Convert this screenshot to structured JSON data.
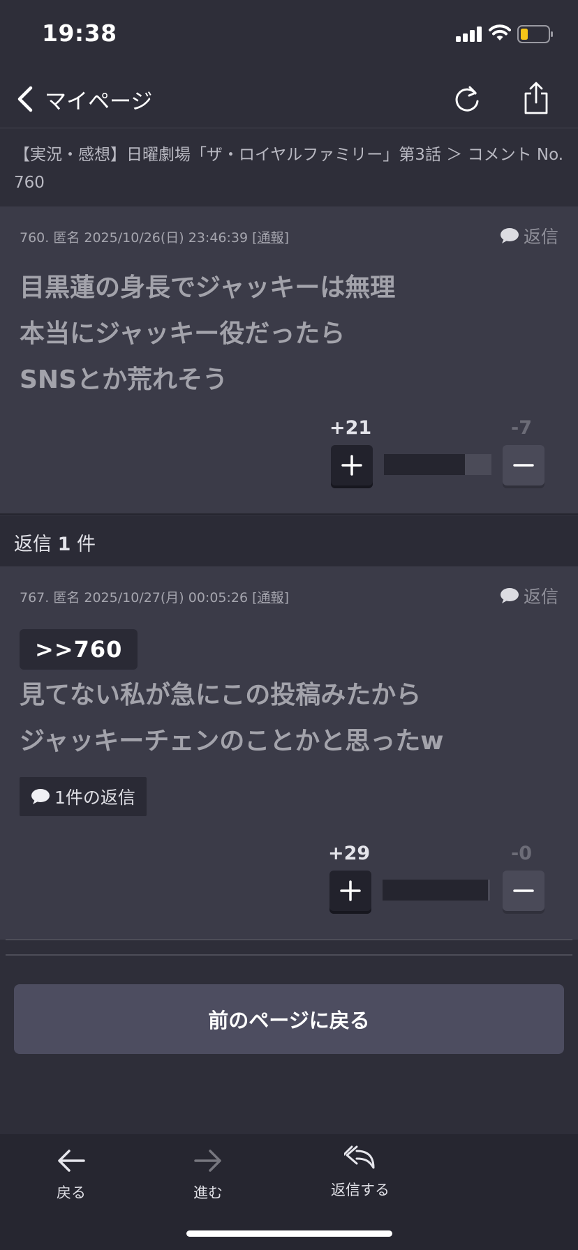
{
  "status_bar": {
    "time": "19:38",
    "battery_color": "#f5c518",
    "icons": [
      "signal-icon",
      "wifi-icon",
      "battery-icon"
    ]
  },
  "nav": {
    "back_label": "マイページ",
    "icons": [
      "chevron-left-icon",
      "reload-icon",
      "share-icon"
    ]
  },
  "breadcrumb": "【実況・感想】日曜劇場「ザ・ロイヤルファミリー」第3話 ＞ コメント No. 760",
  "comments": [
    {
      "meta_prefix": "760. 匿名 2025/10/26(日) 23:46:39 [",
      "report_label": "通報",
      "meta_suffix": "]",
      "reply_label": "返信",
      "lines": [
        "目黒蓮の身長でジャッキーは無理",
        "本当にジャッキー役だったら",
        "SNSとか荒れそう"
      ],
      "plus_count": "+21",
      "minus_count": "-7",
      "plus_ratio": 0.75
    },
    {
      "meta_prefix": "767. 匿名 2025/10/27(月) 00:05:26 [",
      "report_label": "通報",
      "meta_suffix": "]",
      "reply_label": "返信",
      "anchor": ">>760",
      "lines": [
        "見てない私が急にこの投稿みたから",
        "ジャッキーチェンのことかと思ったw"
      ],
      "replies_chip": "1件の返信",
      "plus_count": "+29",
      "minus_count": "-0",
      "plus_ratio": 0.98
    }
  ],
  "replies_header": {
    "prefix": "返信",
    "count": "1",
    "suffix": "件"
  },
  "prev_page_button": "前のページに戻る",
  "toolbar": {
    "back": "戻る",
    "forward": "進む",
    "reply": "返信する"
  }
}
